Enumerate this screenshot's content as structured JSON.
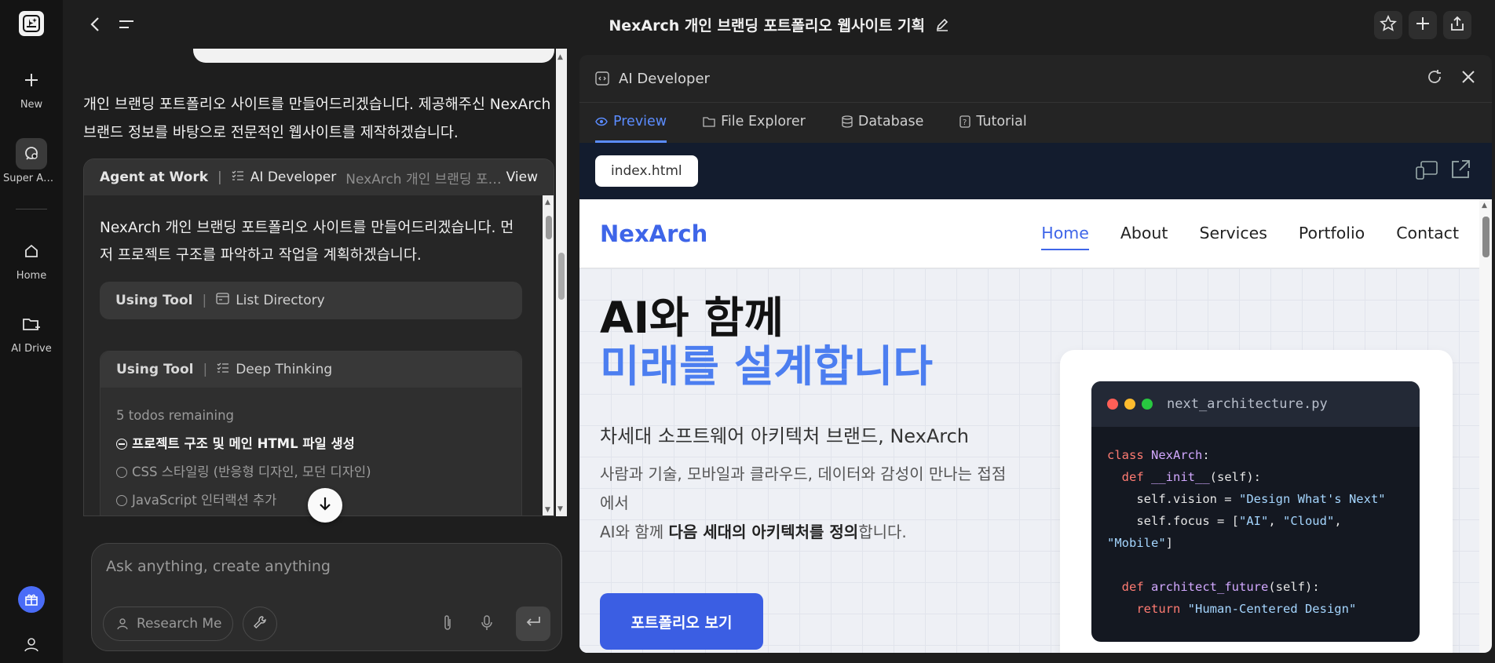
{
  "rail": {
    "new_label": "New",
    "super_agent_label": "Super Agent",
    "home_label": "Home",
    "ai_drive_label": "AI Drive"
  },
  "header": {
    "title": "NexArch 개인 브랜딩 포트폴리오 웹사이트 기획"
  },
  "chat": {
    "intro": "개인 브랜딩 포트폴리오 사이트를 만들어드리겠습니다. 제공해주신 NexArch 브랜드 정보를 바탕으로 전문적인 웹사이트를 제작하겠습니다.",
    "agent_card": {
      "status": "Agent at Work",
      "agent_name": "AI Developer",
      "subtitle": "NexArch 개인 브랜딩 포트폴리오 웹사이트 기획",
      "view_label": "View",
      "message": "NexArch 개인 브랜딩 포트폴리오 사이트를 만들어드리겠습니다. 먼저 프로젝트 구조를 파악하고 작업을 계획하겠습니다.",
      "tool1_label": "Using Tool",
      "tool1_name": "List Directory",
      "tool2_label": "Using Tool",
      "tool2_name": "Deep Thinking",
      "todos_remaining": "5 todos remaining",
      "todos": [
        "프로젝트 구조 및 메인 HTML 파일 생성",
        "CSS 스타일링 (반응형 디자인, 모던 디자인)",
        "JavaScript 인터랙션 추가"
      ]
    },
    "input_placeholder": "Ask anything, create anything",
    "research_label": "Research Me"
  },
  "panel": {
    "title": "AI Developer",
    "tabs": [
      "Preview",
      "File Explorer",
      "Database",
      "Tutorial"
    ],
    "file_chip": "index.html"
  },
  "site": {
    "logo": "NexArch",
    "nav": [
      "Home",
      "About",
      "Services",
      "Portfolio",
      "Contact"
    ],
    "hero_line1": "AI와 함께",
    "hero_line2": "미래를 설계합니다",
    "hero_sub": "차세대 소프트웨어 아키텍처 브랜드, NexArch",
    "hero_desc_1": "사람과 기술, 모바일과 클라우드, 데이터와 감성이 만나는 접점에서",
    "hero_desc_2a": "AI와 함께 ",
    "hero_desc_2b": "다음 세대의 아키텍처를 정의",
    "hero_desc_2c": "합니다.",
    "hero_button": "포트폴리오 보기",
    "code_filename": "next_architecture.py",
    "code_lines": {
      "l1_kw": "class",
      "l1_name": "NexArch",
      "l1_tail": ":",
      "l2_kw": "def",
      "l2_name": "__init__",
      "l2_tail": "(self):",
      "l3": "self.vision = ",
      "l3_str": "\"Design What's Next\"",
      "l4": "self.focus = [",
      "l4_s1": "\"AI\"",
      "l4_s2": "\"Cloud\"",
      "l4_s3": "\"Mobile\"",
      "l4_tail": "]",
      "l6_kw": "def",
      "l6_name": "architect_future",
      "l6_tail": "(self):",
      "l7_kw": "return",
      "l7_str": "\"Human-Centered Design\""
    }
  },
  "colors": {
    "accent": "#4c7ef0",
    "button": "#3b5ee3",
    "tab_active": "#5b8cff"
  }
}
